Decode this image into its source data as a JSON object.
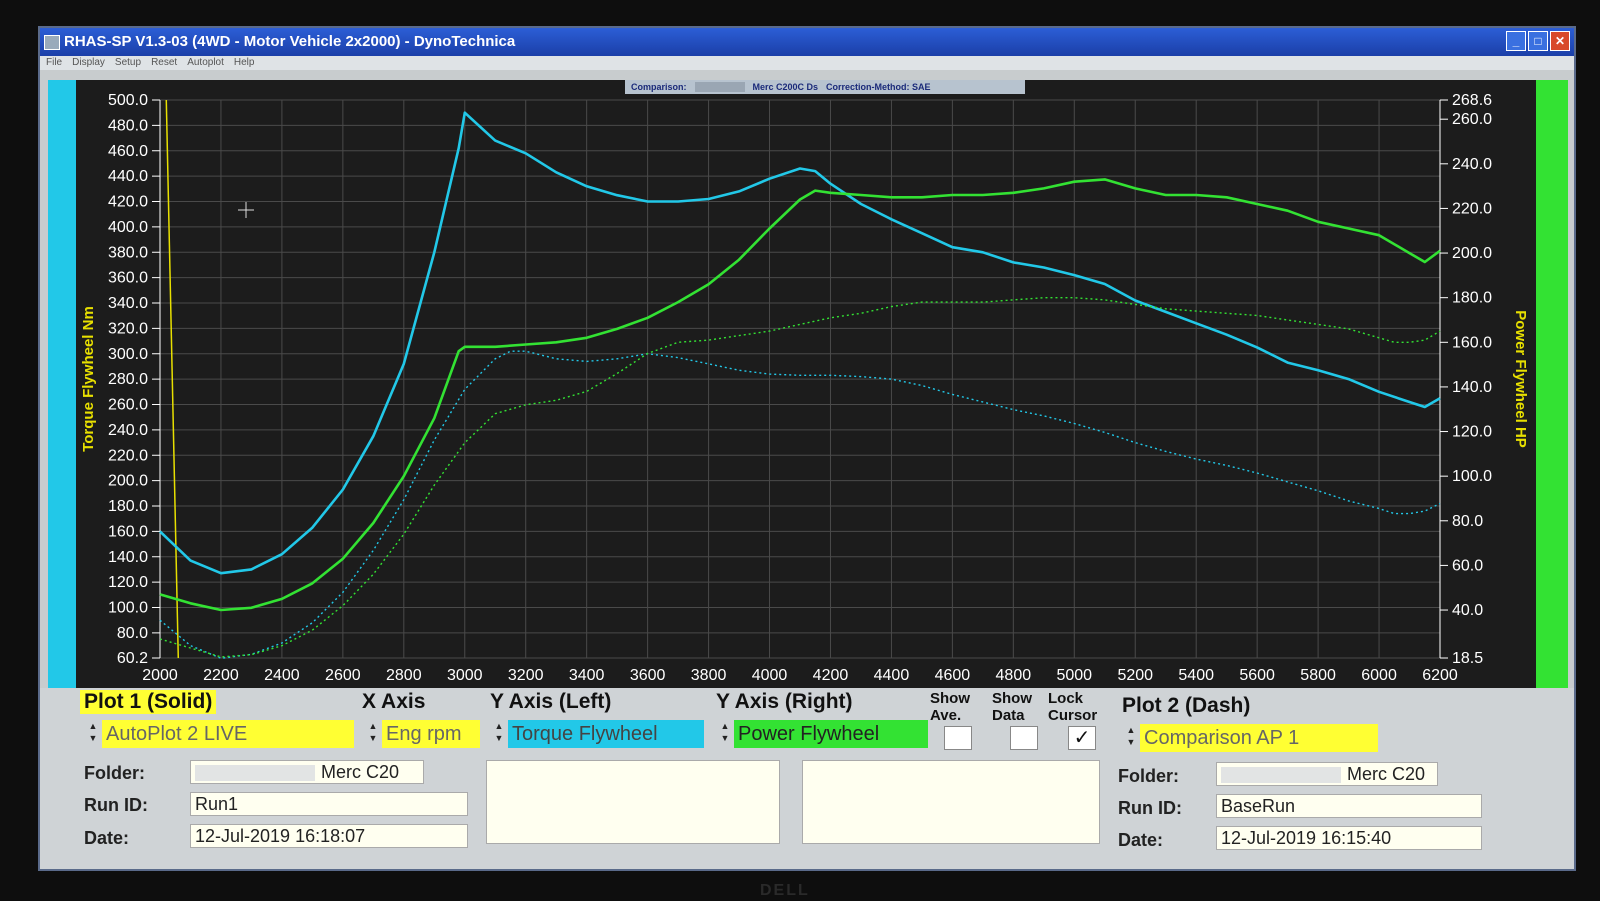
{
  "window": {
    "title": "RHAS-SP V1.3-03  (4WD - Motor Vehicle 2x2000) - DynoTechnica",
    "menu": [
      "File",
      "Display",
      "Setup",
      "Reset",
      "Autoplot",
      "Help"
    ]
  },
  "comparison_bar": {
    "label": "Comparison:",
    "run": "Merc C200C Ds",
    "correction": "Correction-Method: SAE"
  },
  "colors": {
    "plot_bg": "#1c1c1c",
    "grid": "#4a4a4a",
    "torque": "#22c8e8",
    "power": "#33e233",
    "axis_title": "#e8e000",
    "cursor": "#e8e000"
  },
  "chart_data": {
    "type": "line",
    "xlabel": "",
    "ylabel": "Torque Flywheel Nm",
    "y2label": "Power Flywheel HP",
    "xlim": [
      2000,
      6200
    ],
    "ylim": [
      60.2,
      500.0
    ],
    "y2lim": [
      18.5,
      268.6
    ],
    "x_ticks": [
      "2000",
      "2200",
      "2400",
      "2600",
      "2800",
      "3000",
      "3200",
      "3400",
      "3600",
      "3800",
      "4000",
      "4200",
      "4400",
      "4600",
      "4800",
      "5000",
      "5200",
      "5400",
      "5600",
      "5800",
      "6000",
      "6200"
    ],
    "y_ticks": [
      "500.0",
      "480.0",
      "460.0",
      "440.0",
      "420.0",
      "400.0",
      "380.0",
      "360.0",
      "340.0",
      "320.0",
      "300.0",
      "280.0",
      "260.0",
      "240.0",
      "220.0",
      "200.0",
      "180.0",
      "160.0",
      "140.0",
      "120.0",
      "100.0",
      "80.0",
      "60.2"
    ],
    "y2_ticks": [
      "268.6",
      "260.0",
      "240.0",
      "220.0",
      "200.0",
      "180.0",
      "160.0",
      "140.0",
      "120.0",
      "100.0",
      "80.0",
      "60.0",
      "40.0",
      "18.5"
    ],
    "grid": true,
    "cursor_x": 2060,
    "series": [
      {
        "style": "solid",
        "axis": "left",
        "color": "torque",
        "x": [
          2000,
          2100,
          2200,
          2300,
          2400,
          2500,
          2600,
          2700,
          2800,
          2900,
          2980,
          3000,
          3100,
          3200,
          3300,
          3400,
          3500,
          3600,
          3700,
          3800,
          3900,
          4000,
          4100,
          4150,
          4200,
          4300,
          4400,
          4500,
          4600,
          4700,
          4800,
          4900,
          5000,
          5100,
          5200,
          5300,
          5400,
          5500,
          5600,
          5700,
          5800,
          5900,
          6000,
          6100,
          6150,
          6200
        ],
        "y": [
          160,
          137,
          127,
          130,
          142,
          163,
          193,
          235,
          292,
          380,
          462,
          490,
          468,
          458,
          443,
          432,
          425,
          420,
          420,
          422,
          428,
          438,
          446,
          444,
          434,
          418,
          406,
          395,
          384,
          380,
          372,
          368,
          362,
          355,
          342,
          333,
          324,
          315,
          305,
          293,
          287,
          280,
          270,
          262,
          258,
          265
        ]
      },
      {
        "style": "solid",
        "axis": "right",
        "color": "power",
        "x": [
          2000,
          2100,
          2200,
          2300,
          2400,
          2500,
          2600,
          2700,
          2800,
          2900,
          2980,
          3000,
          3100,
          3200,
          3300,
          3400,
          3500,
          3600,
          3700,
          3800,
          3900,
          4000,
          4100,
          4150,
          4200,
          4300,
          4400,
          4500,
          4600,
          4700,
          4800,
          4900,
          5000,
          5100,
          5200,
          5300,
          5400,
          5500,
          5600,
          5700,
          5800,
          5900,
          6000,
          6100,
          6150,
          6200
        ],
        "y": [
          47,
          43,
          40,
          41,
          45,
          52,
          63,
          79,
          100,
          126,
          156,
          158,
          158,
          159,
          160,
          162,
          166,
          171,
          178,
          186,
          197,
          211,
          224,
          228,
          227,
          226,
          225,
          225,
          226,
          226,
          227,
          229,
          232,
          233,
          229,
          226,
          226,
          225,
          222,
          219,
          214,
          211,
          208,
          200,
          196,
          201
        ]
      },
      {
        "style": "dashed",
        "axis": "left",
        "color": "torque",
        "x": [
          2000,
          2100,
          2200,
          2300,
          2400,
          2500,
          2600,
          2700,
          2800,
          2900,
          3000,
          3100,
          3150,
          3200,
          3300,
          3400,
          3500,
          3600,
          3700,
          3800,
          3900,
          4000,
          4100,
          4200,
          4300,
          4400,
          4500,
          4600,
          4700,
          4800,
          4900,
          5000,
          5100,
          5200,
          5300,
          5400,
          5500,
          5600,
          5700,
          5800,
          5900,
          6000,
          6050,
          6100,
          6150,
          6200
        ],
        "y": [
          90,
          70,
          60,
          63,
          72,
          88,
          112,
          145,
          185,
          232,
          272,
          296,
          302,
          302,
          296,
          294,
          296,
          300,
          297,
          292,
          287,
          284,
          283,
          283,
          282,
          280,
          275,
          268,
          262,
          256,
          251,
          245,
          238,
          230,
          223,
          217,
          212,
          206,
          199,
          192,
          184,
          178,
          174,
          174,
          176,
          182
        ]
      },
      {
        "style": "dashed",
        "axis": "right",
        "color": "power",
        "x": [
          2000,
          2100,
          2200,
          2300,
          2400,
          2500,
          2600,
          2700,
          2800,
          2900,
          3000,
          3100,
          3200,
          3300,
          3400,
          3500,
          3600,
          3700,
          3800,
          3900,
          4000,
          4100,
          4200,
          4300,
          4400,
          4500,
          4600,
          4700,
          4800,
          4900,
          5000,
          5100,
          5200,
          5300,
          5400,
          5500,
          5600,
          5700,
          5800,
          5900,
          6000,
          6050,
          6100,
          6150,
          6200
        ],
        "y": [
          27,
          23,
          19,
          20,
          24,
          31,
          42,
          56,
          74,
          96,
          115,
          128,
          132,
          134,
          138,
          146,
          155,
          160,
          161,
          163,
          165,
          168,
          171,
          173,
          176,
          178,
          178,
          178,
          179,
          180,
          180,
          179,
          177,
          175,
          174,
          173,
          172,
          170,
          168,
          166,
          162,
          160,
          160,
          161,
          165
        ]
      }
    ]
  },
  "controls": {
    "plot1_header": "Plot 1 (Solid)",
    "xaxis_header": "X Axis",
    "yleft_header": "Y Axis (Left)",
    "yright_header": "Y Axis (Right)",
    "show_ave_header": "Show Ave.",
    "show_data_header": "Show Data",
    "lock_cursor_header": "Lock Cursor",
    "plot2_header": "Plot 2 (Dash)",
    "plot1_select": "AutoPlot 2 LIVE",
    "xaxis_select": "Eng rpm",
    "yleft_select": "Torque Flywheel",
    "yright_select": "Power Flywheel",
    "plot2_select": "Comparison AP 1",
    "show_ave_checked": false,
    "show_data_checked": false,
    "lock_cursor_checked": true,
    "check_mark": "✓",
    "plot1": {
      "folder_label": "Folder:",
      "folder": "Merc C20",
      "runid_label": "Run ID:",
      "runid": "Run1",
      "date_label": "Date:",
      "date": "12-Jul-2019  16:18:07"
    },
    "plot2": {
      "folder_label": "Folder:",
      "folder": "Merc C20",
      "runid_label": "Run ID:",
      "runid": "BaseRun",
      "date_label": "Date:",
      "date": "12-Jul-2019  16:15:40"
    }
  },
  "monitor_brand": "DELL"
}
